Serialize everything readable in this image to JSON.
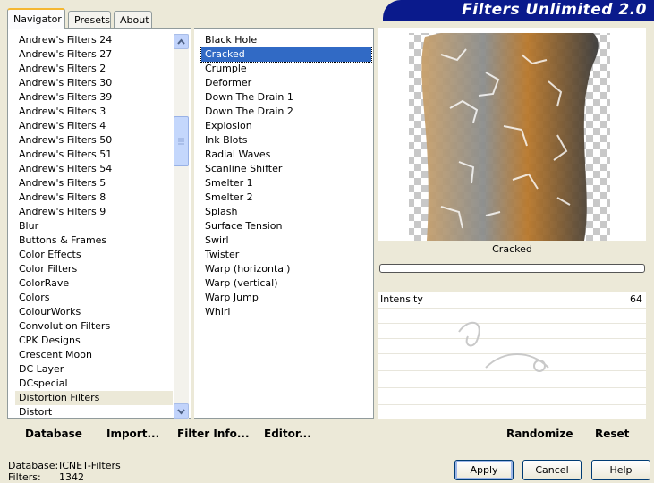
{
  "tabs": [
    {
      "label": "Navigator",
      "active": true
    },
    {
      "label": "Presets",
      "active": false
    },
    {
      "label": "About",
      "active": false
    }
  ],
  "banner": {
    "title": "Filters Unlimited 2.0"
  },
  "categories": [
    "Andrew's Filters 24",
    "Andrew's Filters 27",
    "Andrew's Filters 2",
    "Andrew's Filters 30",
    "Andrew's Filters 39",
    "Andrew's Filters 3",
    "Andrew's Filters 4",
    "Andrew's Filters 50",
    "Andrew's Filters 51",
    "Andrew's Filters 54",
    "Andrew's Filters 5",
    "Andrew's Filters 8",
    "Andrew's Filters 9",
    "Blur",
    "Buttons & Frames",
    "Color Effects",
    "Color Filters",
    "ColorRave",
    "Colors",
    "ColourWorks",
    "Convolution Filters",
    "CPK Designs",
    "Crescent Moon",
    "DC Layer",
    "DCspecial",
    "Distortion Filters",
    "Distort"
  ],
  "selected_category": "Distortion Filters",
  "filters": [
    "Black Hole",
    "Cracked",
    "Crumple",
    "Deformer",
    "Down The Drain 1",
    "Down The Drain 2",
    "Explosion",
    "Ink Blots",
    "Radial Waves",
    "Scanline Shifter",
    "Smelter 1",
    "Smelter 2",
    "Splash",
    "Surface Tension",
    "Swirl",
    "Twister",
    "Warp (horizontal)",
    "Warp (vertical)",
    "Warp Jump",
    "Whirl"
  ],
  "selected_filter": "Cracked",
  "toolbar": {
    "database": "Database",
    "import": "Import...",
    "filter_info": "Filter Info...",
    "editor": "Editor...",
    "randomize": "Randomize",
    "reset": "Reset"
  },
  "preview": {
    "filter_name": "Cracked",
    "progress": 0
  },
  "params": [
    {
      "label": "Intensity",
      "value": "64"
    }
  ],
  "status": {
    "database_label": "Database:",
    "database_value": "ICNET-Filters",
    "filters_label": "Filters:",
    "filters_value": "1342"
  },
  "buttons": {
    "apply": "Apply",
    "cancel": "Cancel",
    "help": "Help"
  },
  "colors": {
    "accent": "#316ac5",
    "banner": "#0a1a8c",
    "face": "#ece9d8"
  }
}
